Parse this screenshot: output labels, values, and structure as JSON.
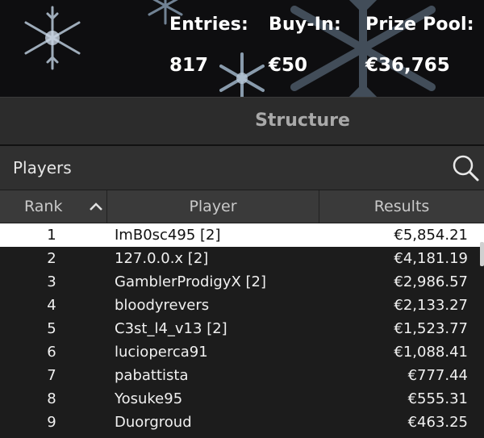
{
  "banner": {
    "entries_label": "Entries:",
    "entries_value": "817",
    "buyin_label": "Buy-In:",
    "buyin_value": "€50",
    "prizepool_label": "Prize Pool:",
    "prizepool_value": "€36,765"
  },
  "tabs": {
    "structure": "Structure"
  },
  "players_panel": {
    "title": "Players",
    "search_icon": "search-icon"
  },
  "table": {
    "headers": {
      "rank": "Rank",
      "player": "Player",
      "results": "Results"
    },
    "sort_icon": "chevron-up-icon",
    "selected_row": 0,
    "rows": [
      {
        "rank": "1",
        "player": "ImB0sc495 [2]",
        "result": "€5,854.21"
      },
      {
        "rank": "2",
        "player": "127.0.0.x [2]",
        "result": "€4,181.19"
      },
      {
        "rank": "3",
        "player": "GamblerProdigyX [2]",
        "result": "€2,986.57"
      },
      {
        "rank": "4",
        "player": "bloodyrevers",
        "result": "€2,133.27"
      },
      {
        "rank": "5",
        "player": "C3st_l4_v13 [2]",
        "result": "€1,523.77"
      },
      {
        "rank": "6",
        "player": "lucioperca91",
        "result": "€1,088.41"
      },
      {
        "rank": "7",
        "player": "pabattista",
        "result": "€777.44"
      },
      {
        "rank": "8",
        "player": "Yosuke95",
        "result": "€555.31"
      },
      {
        "rank": "9",
        "player": "Duorgroud",
        "result": "€463.25"
      }
    ]
  },
  "colors": {
    "banner_bg": "#0e0e10",
    "panel_bg": "#1c1c1c",
    "selected_row_bg": "#ffffff"
  }
}
